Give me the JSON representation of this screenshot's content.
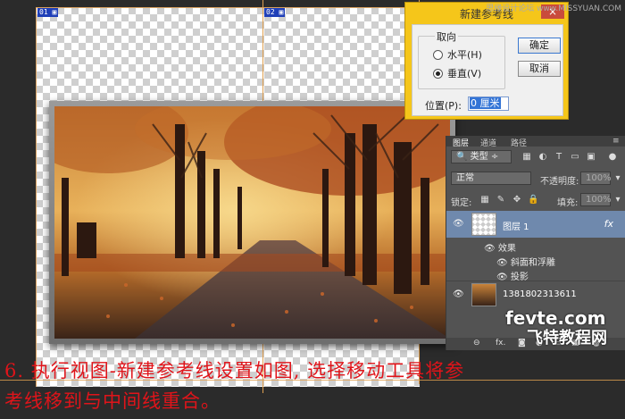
{
  "watermark_site": "思缘设计论坛 www.MISSYUAN.COM",
  "slices": [
    "01",
    "02"
  ],
  "dialog": {
    "title": "新建参考线",
    "close": "×",
    "group_label": "取向",
    "orientation_horizontal": "水平(H)",
    "orientation_vertical": "垂直(V)",
    "selected": "vertical",
    "ok": "确定",
    "cancel": "取消",
    "position_label": "位置(P):",
    "position_value": "0 厘米"
  },
  "layers_panel": {
    "tabs": [
      "图层",
      "通道",
      "路径"
    ],
    "filter": "类型",
    "blend_mode": "正常",
    "opacity_label": "不透明度:",
    "opacity_value": "100%",
    "lock_label": "锁定:",
    "fill_label": "填充:",
    "fill_value": "100%",
    "layers": [
      {
        "name": "图层 1",
        "fx": "fx",
        "selected": true
      },
      {
        "name": "1381802313611",
        "selected": false
      }
    ],
    "effects_label": "效果",
    "effects": [
      "斜面和浮雕",
      "投影"
    ],
    "bottom_icons": [
      "⊖",
      "fx.",
      "◙",
      "◐",
      "▭",
      "▣",
      "🗑"
    ]
  },
  "watermark": {
    "line1": "fevte.com",
    "line2": "飞特教程网"
  },
  "caption": {
    "line1": "6. 执行视图-新建参考线设置如图, 选择移动工具将参",
    "line2": "考线移到与中间线重合。"
  }
}
